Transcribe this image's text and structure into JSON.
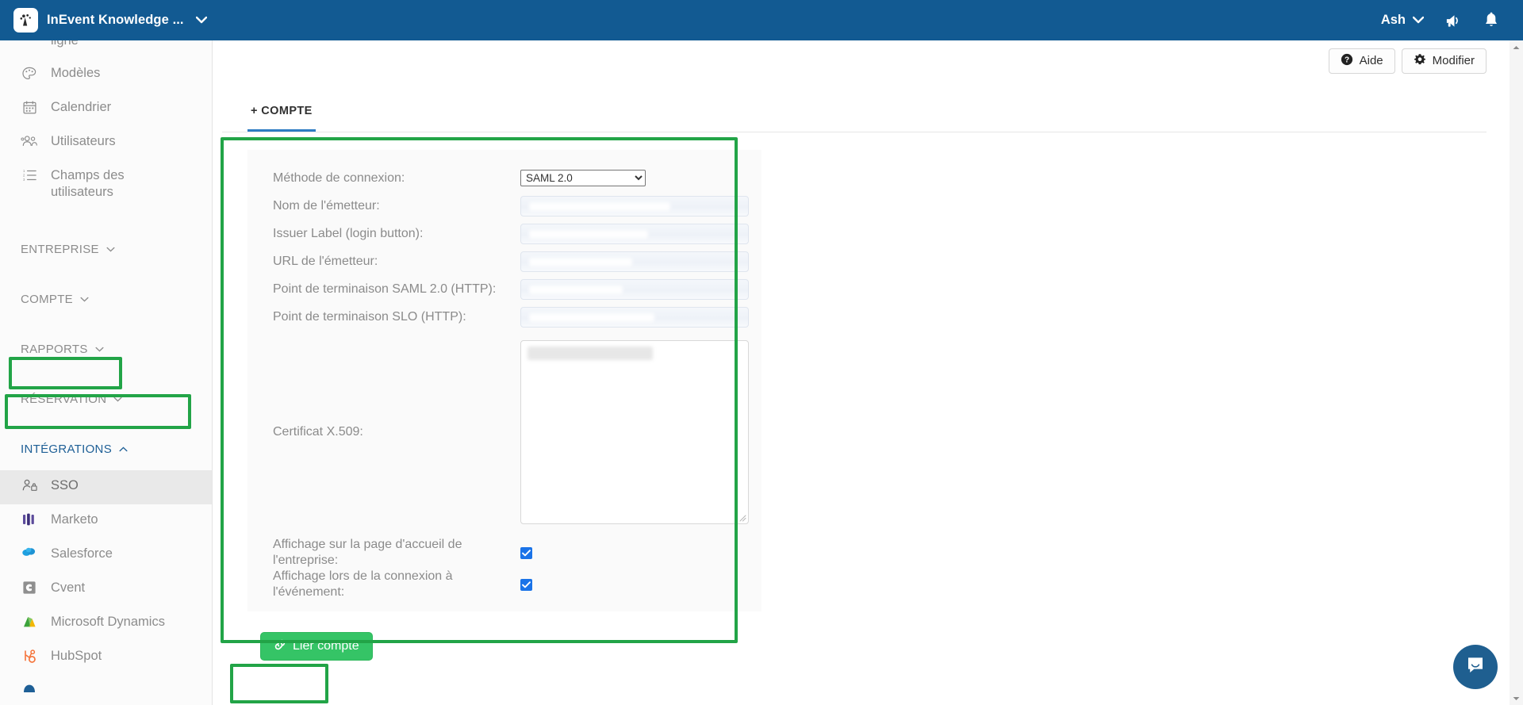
{
  "topbar": {
    "brand_title": "InEvent Knowledge ...",
    "brand_caret": "⌄",
    "user_name": "Ash",
    "user_caret": "⌄",
    "logo_icon": "company-logo-icon",
    "megaphone_icon": "megaphone-icon",
    "bell_icon": "bell-icon",
    "accent_color": "#125A92"
  },
  "sidebar": {
    "truncated_item": "ligne",
    "items": [
      {
        "label": "Modèles",
        "icon": "palette-icon"
      },
      {
        "label": "Calendrier",
        "icon": "calendar-icon"
      },
      {
        "label": "Utilisateurs",
        "icon": "users-icon"
      },
      {
        "label": "Champs des utilisateurs",
        "icon": "list-fields-icon"
      }
    ],
    "groups": [
      {
        "label": "ENTREPRISE",
        "caret": "⌄",
        "open": false
      },
      {
        "label": "COMPTE",
        "caret": "⌄",
        "open": false
      },
      {
        "label": "RAPPORTS",
        "caret": "⌄",
        "open": false
      },
      {
        "label": "RÉSERVATION",
        "caret": "⌄",
        "open": false
      },
      {
        "label": "INTÉGRATIONS",
        "caret": "⌃",
        "open": true
      }
    ],
    "integration_items": [
      {
        "label": "SSO",
        "icon": "user-lock-icon",
        "active": true
      },
      {
        "label": "Marketo",
        "icon": "marketo-icon",
        "active": false
      },
      {
        "label": "Salesforce",
        "icon": "salesforce-icon",
        "active": false
      },
      {
        "label": "Cvent",
        "icon": "cvent-icon",
        "active": false
      },
      {
        "label": "Microsoft Dynamics",
        "icon": "microsoft-dynamics-icon",
        "active": false
      },
      {
        "label": "HubSpot",
        "icon": "hubspot-icon",
        "active": false
      }
    ],
    "highlight_color": "#22a447"
  },
  "toolbar": {
    "help_label": "Aide",
    "help_icon": "question-circle-icon",
    "edit_label": "Modifier",
    "edit_icon": "gear-icon"
  },
  "tabs": [
    {
      "label": "+ COMPTE",
      "active": true
    }
  ],
  "form": {
    "rows": [
      {
        "label": "Méthode de connexion:",
        "type": "select",
        "value": "SAML 2.0"
      },
      {
        "label": "Nom de l'émetteur:",
        "type": "text",
        "value": ""
      },
      {
        "label": "Issuer Label (login button):",
        "type": "text",
        "value": ""
      },
      {
        "label": "URL de l'émetteur:",
        "type": "text",
        "value": ""
      },
      {
        "label": "Point de terminaison SAML 2.0 (HTTP):",
        "type": "text",
        "value": ""
      },
      {
        "label": "Point de terminaison SLO (HTTP):",
        "type": "text",
        "value": ""
      },
      {
        "label": "Certificat X.509:",
        "type": "textarea",
        "value": ""
      }
    ],
    "method_options": [
      "SAML 2.0"
    ],
    "checkboxes": [
      {
        "label": "Affichage sur la page d'accueil de l'entreprise:",
        "checked": true
      },
      {
        "label": "Affichage lors de la connexion à l'événement:",
        "checked": true
      }
    ],
    "submit_label": "Lier compte",
    "submit_icon": "link-chain-icon",
    "submit_color": "#35c466"
  },
  "chat": {
    "icon": "intercom-chat-icon",
    "color": "#1f5f90"
  }
}
